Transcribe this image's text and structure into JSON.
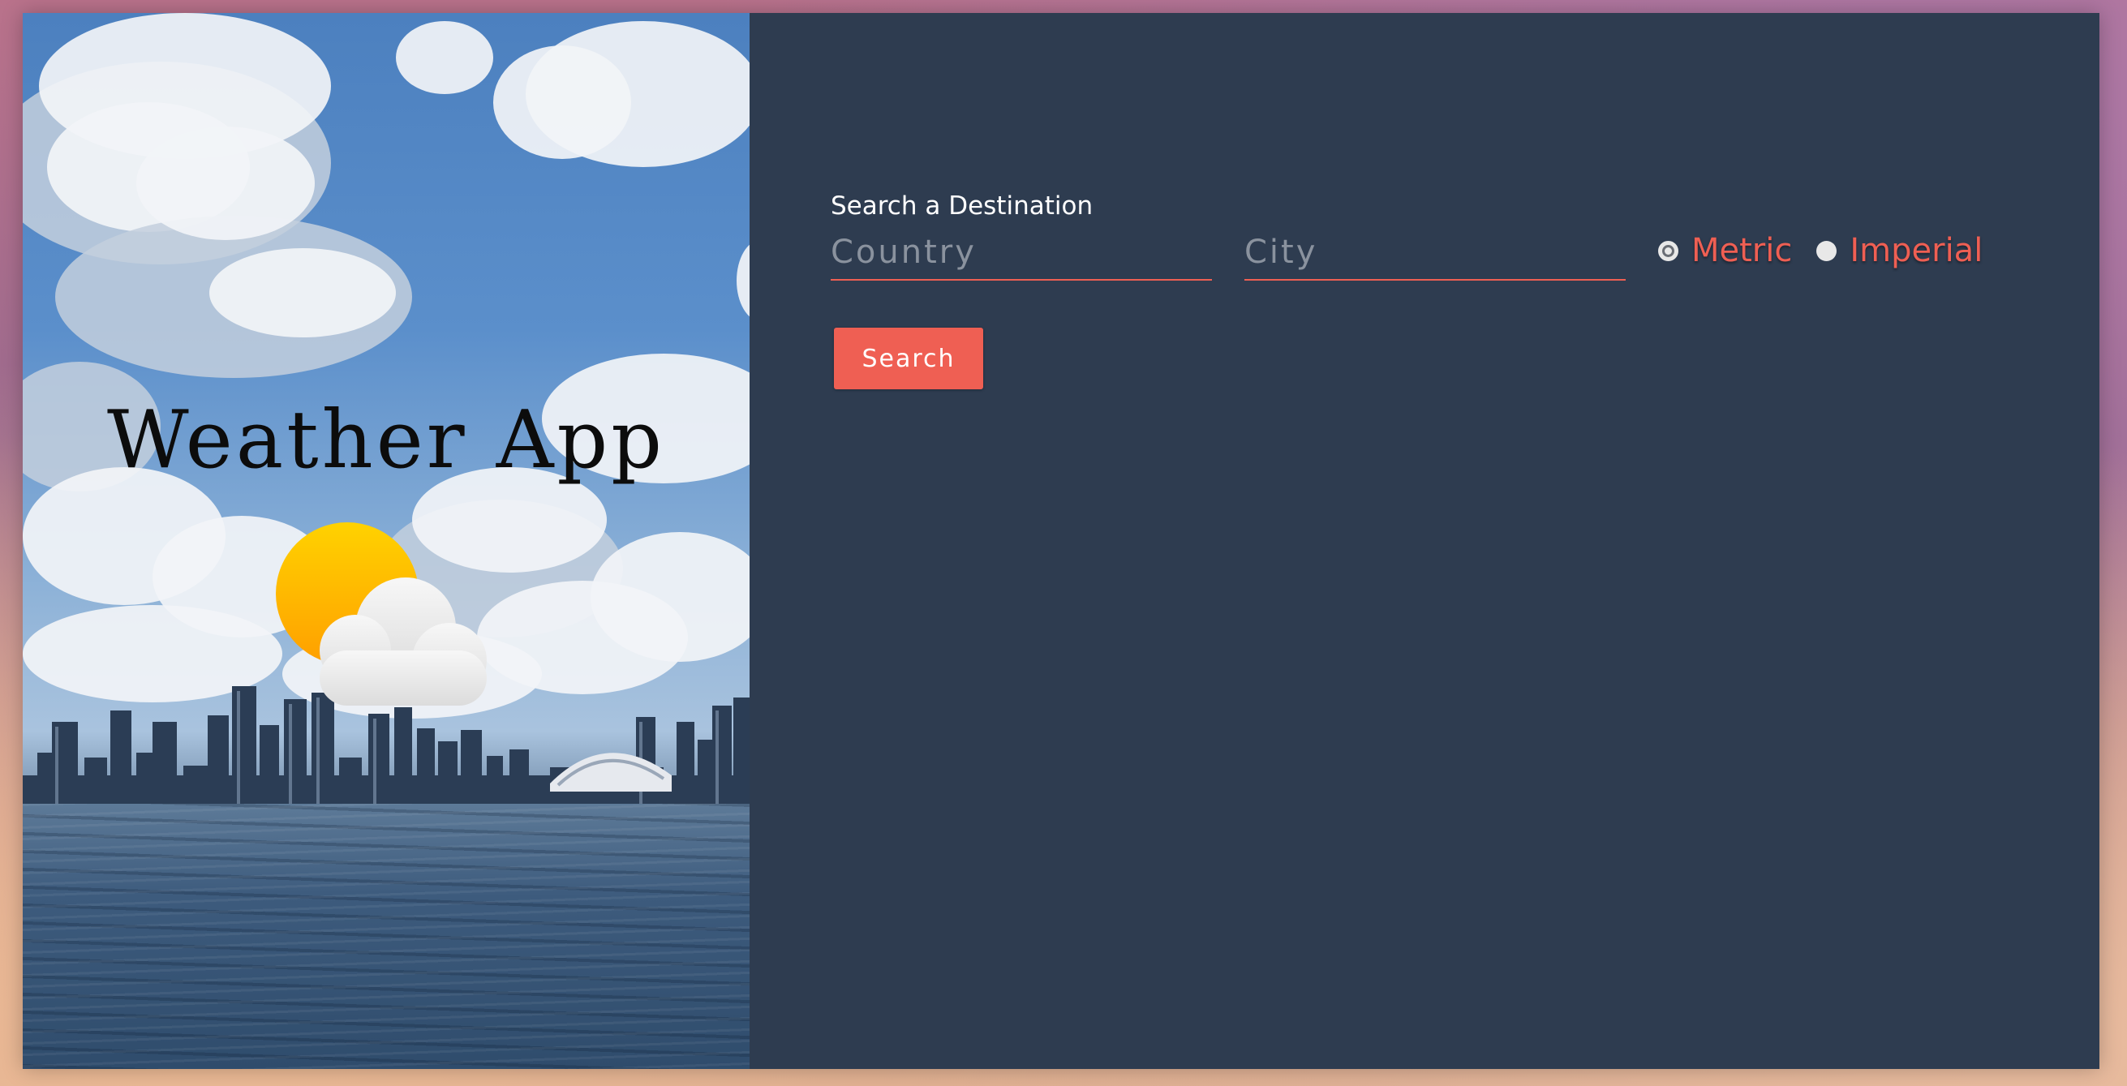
{
  "hero": {
    "title": "Weather App",
    "icon": "partly-cloudy-icon"
  },
  "search": {
    "label": "Search a Destination",
    "country_placeholder": "Country",
    "country_value": "",
    "city_placeholder": "City",
    "city_value": "",
    "units": [
      {
        "label": "Metric",
        "selected": true
      },
      {
        "label": "Imperial",
        "selected": false
      }
    ],
    "button_label": "Search"
  },
  "colors": {
    "accent": "#ef5f53",
    "panel_background": "#2e3c50",
    "label_text": "#ffffff"
  }
}
